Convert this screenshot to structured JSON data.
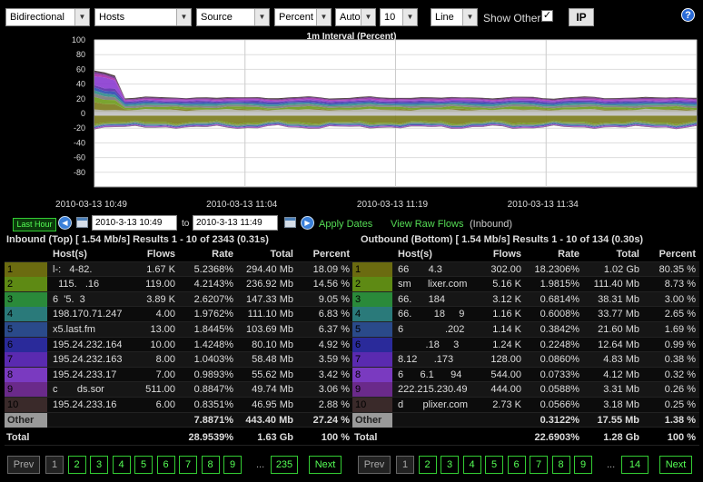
{
  "toolbar": {
    "direction": "Bidirectional",
    "type": "Hosts",
    "source": "Source",
    "unit": "Percent",
    "scale": "Auto",
    "count": "10",
    "chart_style": "Line",
    "show_other_label": "Show Other",
    "show_other_checked": "✓",
    "ip_label": "IP",
    "help_icon": "?"
  },
  "chart_data": {
    "type": "area",
    "title": "1m Interval (Percent)",
    "ylim": [
      -100,
      100
    ],
    "yticks": [
      "100",
      "80",
      "60",
      "40",
      "20",
      "0",
      "-20",
      "-40",
      "-60",
      "-80"
    ],
    "xticks": [
      "2010-03-13 10:49",
      "2010-03-13 11:04",
      "2010-03-13 11:19",
      "2010-03-13 11:34"
    ],
    "grid": true,
    "series_colors": [
      "#7a7a1a",
      "#6b9a1a",
      "#7a7a7a",
      "#2f8a8a",
      "#2a4ab0",
      "#5a2aa8",
      "#8a3ad0",
      "#a82aa8",
      "#6a2a8a",
      "#3a2a2a",
      "#c0c0c0"
    ]
  },
  "datebar": {
    "last_hour": "Last Hour",
    "start": "2010-3-13 10:49",
    "to": "to",
    "end": "2010-3-13 11:49",
    "apply": "Apply Dates",
    "raw_flows": "View Raw Flows",
    "raw_flows_suffix": "(Inbound)"
  },
  "inbound": {
    "title": "Inbound (Top) [ 1.54 Mb/s] Results 1 - 10 of 2343 (0.31s)",
    "headers": [
      "Host(s)",
      "Flows",
      "Rate",
      "Total",
      "Percent"
    ],
    "rows": [
      {
        "n": "1",
        "host": "l-:   4-82.",
        "flows": "1.67 K",
        "rate": "5.2368%",
        "total": "294.40 Mb",
        "pct": "18.09 %",
        "color": "#6b6b10"
      },
      {
        "n": "2",
        "host": "  115.   .16",
        "flows": "119.00",
        "rate": "4.2143%",
        "total": "236.92 Mb",
        "pct": "14.56 %",
        "color": "#5e8a14"
      },
      {
        "n": "3",
        "host": "6  '5.  3",
        "flows": "3.89 K",
        "rate": "2.6207%",
        "total": "147.33 Mb",
        "pct": "9.05 %",
        "color": "#2a8a3a"
      },
      {
        "n": "4",
        "host": "198.170.71.247",
        "flows": "4.00",
        "rate": "1.9762%",
        "total": "111.10 Mb",
        "pct": "6.83 %",
        "color": "#2a7a7a"
      },
      {
        "n": "5",
        "host": "x5.last.fm",
        "flows": "13.00",
        "rate": "1.8445%",
        "total": "103.69 Mb",
        "pct": "6.37 %",
        "color": "#2a4a8a"
      },
      {
        "n": "6",
        "host": "195.24.232.164",
        "flows": "10.00",
        "rate": "1.4248%",
        "total": "80.10 Mb",
        "pct": "4.92 %",
        "color": "#2a2a9a"
      },
      {
        "n": "7",
        "host": "195.24.232.163",
        "flows": "8.00",
        "rate": "1.0403%",
        "total": "58.48 Mb",
        "pct": "3.59 %",
        "color": "#5a2ab0"
      },
      {
        "n": "8",
        "host": "195.24.233.17",
        "flows": "7.00",
        "rate": "0.9893%",
        "total": "55.62 Mb",
        "pct": "3.42 %",
        "color": "#7a3ac0"
      },
      {
        "n": "9",
        "host": "c       ds.sor",
        "flows": "511.00",
        "rate": "0.8847%",
        "total": "49.74 Mb",
        "pct": "3.06 %",
        "color": "#6a2a8a"
      },
      {
        "n": "10",
        "host": "195.24.233.16",
        "flows": "6.00",
        "rate": "0.8351%",
        "total": "46.95 Mb",
        "pct": "2.88 %",
        "color": "#3a2a2a"
      }
    ],
    "other": {
      "label": "Other",
      "rate": "7.8871%",
      "total": "443.40 Mb",
      "pct": "27.24 %"
    },
    "total": {
      "label": "Total",
      "rate": "28.9539%",
      "total": "1.63 Gb",
      "pct": "100 %"
    },
    "pager": {
      "prev": "Prev",
      "pages": [
        "1",
        "2",
        "3",
        "4",
        "5",
        "6",
        "7",
        "8",
        "9"
      ],
      "dots": "...",
      "last": "235",
      "next": "Next"
    }
  },
  "outbound": {
    "title": "Outbound (Bottom) [ 1.54 Mb/s] Results 1 - 10 of 134 (0.30s)",
    "headers": [
      "Host(s)",
      "Flows",
      "Rate",
      "Total",
      "Percent"
    ],
    "rows": [
      {
        "n": "1",
        "host": "66       4.3",
        "flows": "302.00",
        "rate": "18.2306%",
        "total": "1.02 Gb",
        "pct": "80.35 %",
        "color": "#6b6b10"
      },
      {
        "n": "2",
        "host": "sm      lixer.com",
        "flows": "5.16 K",
        "rate": "1.9815%",
        "total": "111.40 Mb",
        "pct": "8.73 %",
        "color": "#5e8a14"
      },
      {
        "n": "3",
        "host": "66.      184",
        "flows": "3.12 K",
        "rate": "0.6814%",
        "total": "38.31 Mb",
        "pct": "3.00 %",
        "color": "#2a8a3a"
      },
      {
        "n": "4",
        "host": "66.        18     9",
        "flows": "1.16 K",
        "rate": "0.6008%",
        "total": "33.77 Mb",
        "pct": "2.65 %",
        "color": "#2a7a7a"
      },
      {
        "n": "5",
        "host": "6               .202",
        "flows": "1.14 K",
        "rate": "0.3842%",
        "total": "21.60 Mb",
        "pct": "1.69 %",
        "color": "#2a4a8a"
      },
      {
        "n": "6",
        "host": "          .18     3",
        "flows": "1.24 K",
        "rate": "0.2248%",
        "total": "12.64 Mb",
        "pct": "0.99 %",
        "color": "#2a2a9a"
      },
      {
        "n": "7",
        "host": "8.12      .173",
        "flows": "128.00",
        "rate": "0.0860%",
        "total": "4.83 Mb",
        "pct": "0.38 %",
        "color": "#5a2ab0"
      },
      {
        "n": "8",
        "host": "6      6.1      94",
        "flows": "544.00",
        "rate": "0.0733%",
        "total": "4.12 Mb",
        "pct": "0.32 %",
        "color": "#7a3ac0"
      },
      {
        "n": "9",
        "host": "222.215.230.49",
        "flows": "444.00",
        "rate": "0.0588%",
        "total": "3.31 Mb",
        "pct": "0.26 %",
        "color": "#6a2a8a"
      },
      {
        "n": "10",
        "host": "d       plixer.com",
        "flows": "2.73 K",
        "rate": "0.0566%",
        "total": "3.18 Mb",
        "pct": "0.25 %",
        "color": "#3a2a2a"
      }
    ],
    "other": {
      "label": "Other",
      "rate": "0.3122%",
      "total": "17.55 Mb",
      "pct": "1.38 %"
    },
    "total": {
      "label": "Total",
      "rate": "22.6903%",
      "total": "1.28 Gb",
      "pct": "100 %"
    },
    "pager": {
      "prev": "Prev",
      "pages": [
        "1",
        "2",
        "3",
        "4",
        "5",
        "6",
        "7",
        "8",
        "9"
      ],
      "dots": "...",
      "last": "14",
      "next": "Next"
    }
  }
}
